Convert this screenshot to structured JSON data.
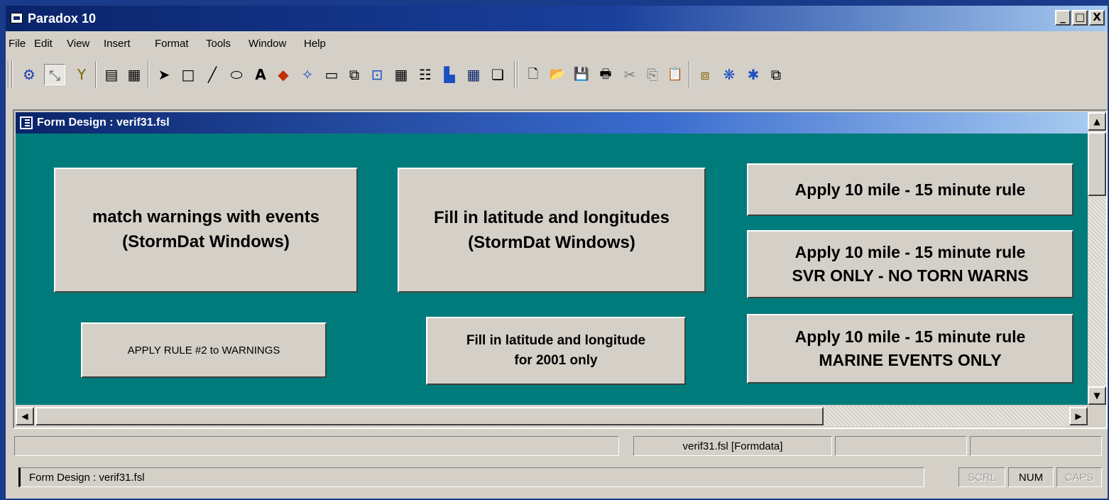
{
  "window": {
    "title": "Paradox 10",
    "controls": [
      "_",
      "□",
      "X"
    ]
  },
  "menu": [
    "File",
    "Edit",
    "View",
    "Insert",
    "Format",
    "Tools",
    "Window",
    "Help"
  ],
  "toolbar": {
    "icons": [
      "run-form-icon",
      "design-icon",
      "filter-icon",
      "form-view-icon",
      "table-view-icon",
      "select-arrow-icon",
      "box-tool-icon",
      "line-tool-icon",
      "ellipse-tool-icon",
      "text-tool-icon",
      "graphic-tool-icon",
      "ole-tool-icon",
      "button-tool-icon",
      "field-tool-icon",
      "record-tool-icon",
      "table-tool-icon",
      "multirecord-tool-icon",
      "chart-tool-icon",
      "crosstab-tool-icon",
      "notebook-tool-icon",
      "new-icon",
      "open-icon",
      "save-icon",
      "print-icon",
      "cut-icon",
      "copy-icon",
      "paste-icon",
      "object-tree-icon",
      "properties-icon",
      "snowflake-icon",
      "window-icon"
    ],
    "glyphs": [
      "⚙",
      "⤡",
      "Y",
      "▤",
      "▦",
      "➤",
      "□",
      "╱",
      "⬭",
      "A",
      "◆",
      "✧",
      "▭",
      "⧉",
      "⊡",
      "▦",
      "☷",
      "▙",
      "▦",
      "❏",
      "🗋",
      "📂",
      "💾",
      "🖶",
      "✂",
      "⎘",
      "📋",
      "⧈",
      "❋",
      "✱",
      "⧉"
    ]
  },
  "form_window": {
    "title": "Form Design : verif31.fsl",
    "buttons": [
      {
        "name": "match-warnings-button",
        "label": "match warnings with events\n(StormDat Windows)"
      },
      {
        "name": "fill-lat-lon-button",
        "label": "Fill in latitude and longitudes\n(StormDat Windows)"
      },
      {
        "name": "apply-rule-button",
        "label": "Apply 10 mile - 15 minute rule"
      },
      {
        "name": "apply-rule-svr-button",
        "label": "Apply 10 mile - 15 minute rule\nSVR ONLY - NO TORN WARNS"
      },
      {
        "name": "apply-rule-2-button",
        "label": "APPLY RULE #2 to WARNINGS"
      },
      {
        "name": "fill-lat-lon-2001-button",
        "label": "Fill in latitude and longitude\nfor 2001 only"
      },
      {
        "name": "apply-rule-marine-button",
        "label": "Apply 10 mile - 15 minute rule\nMARINE EVENTS ONLY"
      }
    ]
  },
  "statusbar": {
    "table_info": "verif31.fsl [Formdata]",
    "message": "Form Design : verif31.fsl",
    "indicators": {
      "scrl": "SCRL",
      "num": "NUM",
      "caps": "CAPS"
    }
  },
  "colors": {
    "canvas": "#007b7b",
    "face": "#d4d0c8",
    "title_dark": "#0a246a"
  }
}
